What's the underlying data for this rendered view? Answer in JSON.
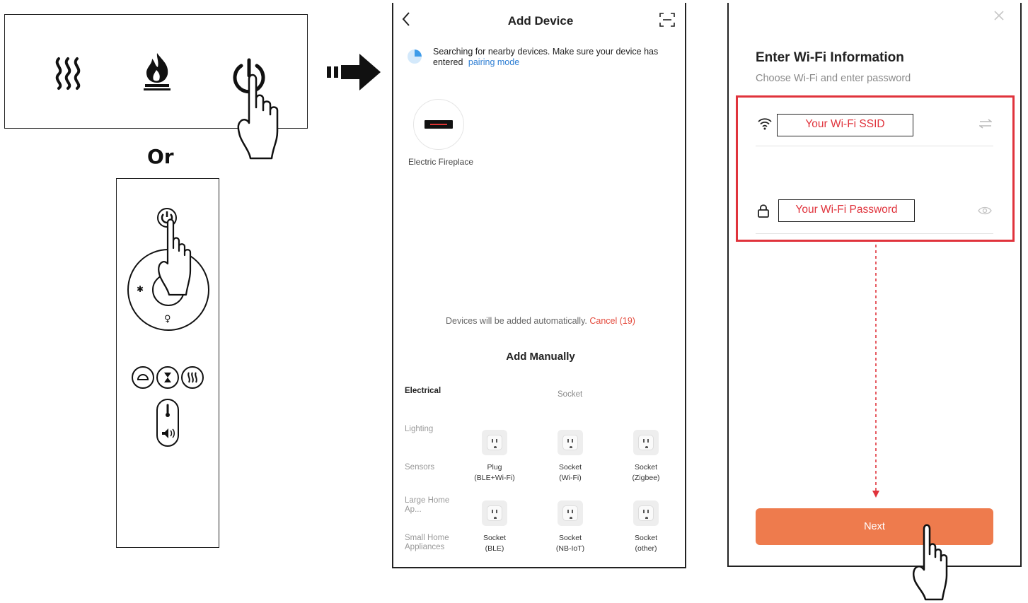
{
  "instruction": {
    "or_label": "Or"
  },
  "add_device_screen": {
    "title": "Add Device",
    "searching_text": "Searching for nearby devices. Make sure your device has entered",
    "pairing_link": "pairing mode",
    "found_device": "Electric Fireplace",
    "auto_add_text": "Devices will be added automatically.",
    "cancel_label": "Cancel (19)",
    "add_manually": "Add Manually",
    "categories": [
      {
        "label": "Electrical",
        "active": true
      },
      {
        "label": "Lighting",
        "active": false
      },
      {
        "label": "Sensors",
        "active": false
      },
      {
        "label": "Large Home Ap...",
        "active": false
      },
      {
        "label": "Small Home Appliances",
        "active": false
      }
    ],
    "section_heading": "Socket",
    "devices": [
      {
        "line1": "Plug",
        "line2": "(BLE+Wi-Fi)"
      },
      {
        "line1": "Socket",
        "line2": "(Wi-Fi)"
      },
      {
        "line1": "Socket",
        "line2": "(Zigbee)"
      },
      {
        "line1": "Socket",
        "line2": "(BLE)"
      },
      {
        "line1": "Socket",
        "line2": "(NB-IoT)"
      },
      {
        "line1": "Socket",
        "line2": "(other)"
      }
    ],
    "icons": [
      "back-arrow-icon",
      "scan-icon",
      "spinner-icon",
      "socket-icon"
    ]
  },
  "wifi_screen": {
    "title": "Enter Wi-Fi Information",
    "subtitle": "Choose Wi-Fi and enter password",
    "ssid_value": "Your Wi-Fi SSID",
    "password_value": "Your Wi-Fi Password",
    "next_label": "Next",
    "icons": [
      "close-icon",
      "wifi-icon",
      "switch-network-icon",
      "lock-icon",
      "eye-icon"
    ]
  },
  "colors": {
    "accent_orange": "#ee7b4d",
    "highlight_red": "#e0333c",
    "link_blue": "#2f7fd4",
    "cancel_red": "#e4493b"
  }
}
